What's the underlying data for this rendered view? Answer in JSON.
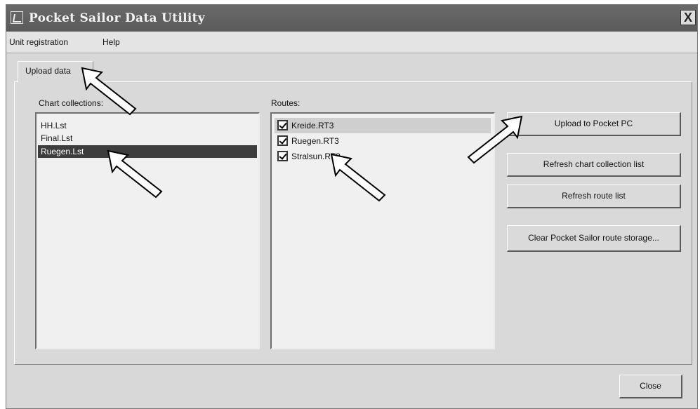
{
  "window": {
    "title": "Pocket Sailor Data Utility",
    "close_glyph": "X"
  },
  "menu": {
    "items": [
      "Unit registration",
      "Help"
    ]
  },
  "tab": {
    "label": "Upload data"
  },
  "chart_collections": {
    "label": "Chart collections:",
    "items": [
      "HH.Lst",
      "Final.Lst",
      "Ruegen.Lst"
    ],
    "selected_index": 2
  },
  "routes": {
    "label": "Routes:",
    "items": [
      {
        "label": "Kreide.RT3",
        "checked": true
      },
      {
        "label": "Ruegen.RT3",
        "checked": true
      },
      {
        "label": "Stralsun.RT3",
        "checked": true
      }
    ]
  },
  "buttons": {
    "upload": "Upload to Pocket PC",
    "refresh_charts": "Refresh chart collection list",
    "refresh_routes": "Refresh route list",
    "clear_storage": "Clear Pocket Sailor route storage...",
    "close": "Close"
  },
  "icons": {
    "app": "app-icon",
    "pointer": "pointer-arrow-icon"
  }
}
